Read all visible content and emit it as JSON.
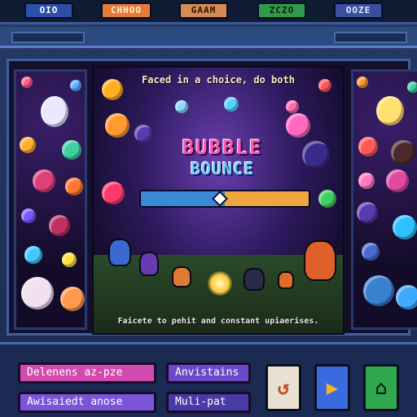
{
  "top_tabs": [
    "OIO",
    "CHHOO",
    "GAAM",
    "ZCZO",
    "OOZE"
  ],
  "game": {
    "tagline": "Faced in a choice, do both",
    "logo_line1": "BUBBLE",
    "logo_line2": "BOUNCE",
    "footer_text": "Faicete to pehit and constant upiaerises."
  },
  "buttons": {
    "b1": "Delenens az-pze",
    "b2": "Awisaiedt anose",
    "b3": "Anvistains",
    "b4": "Muli-pat"
  },
  "icons": {
    "play_icon": "play-icon",
    "refresh_icon": "refresh-icon",
    "save_icon": "save-icon"
  },
  "colors": {
    "accent_pink": "#d04ab0",
    "accent_purple": "#7a55d8",
    "frame_blue": "#3f5fa6"
  }
}
